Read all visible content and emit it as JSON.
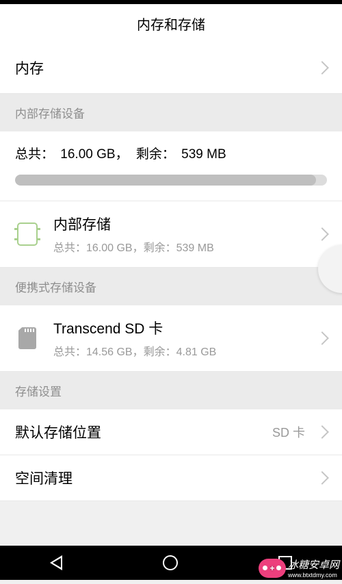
{
  "header": {
    "title": "内存和存储"
  },
  "memory_row": {
    "label": "内存"
  },
  "section_internal": {
    "header": "内部存储设备"
  },
  "summary": {
    "total_label": "总共：",
    "total_value": "16.00 GB，",
    "free_label": "剩余：",
    "free_value": "539 MB"
  },
  "internal_item": {
    "title": "内部存储",
    "sub": "总共：16.00 GB，剩余：539 MB"
  },
  "section_portable": {
    "header": "便携式存储设备"
  },
  "sd_item": {
    "title": "Transcend SD 卡",
    "sub": "总共：14.56 GB，剩余：4.81 GB"
  },
  "section_settings": {
    "header": "存储设置"
  },
  "default_location": {
    "label": "默认存储位置",
    "value": "SD 卡"
  },
  "cleanup": {
    "label": "空间清理"
  },
  "watermark": {
    "text": "冰糖安卓网",
    "url": "www.btxtdmy.com"
  }
}
